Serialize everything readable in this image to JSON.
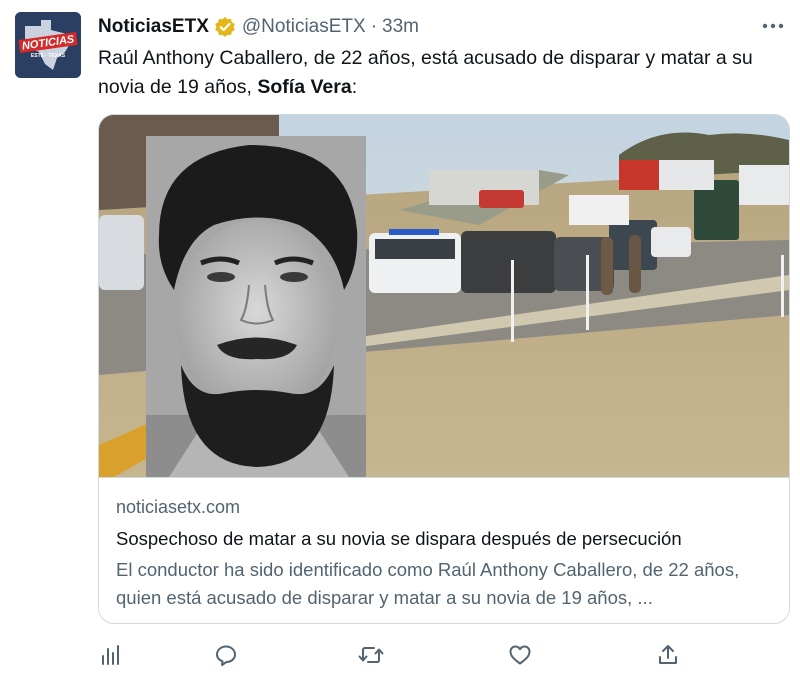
{
  "tweet": {
    "account": {
      "display_name": "NoticiasETX",
      "handle": "@NoticiasETX",
      "separator": "·",
      "time": "33m",
      "avatar_text": "NOTICIAS",
      "avatar_subtext": "ESTE · TEXAS",
      "verified": true
    },
    "text_part1": "Raúl Anthony Caballero, de 22 años, está acusado de disparar y matar a su novia de 19 años, ",
    "text_bold": "Sofía Vera",
    "text_part2": ":",
    "card": {
      "domain": "noticiasetx.com",
      "title": "Sospechoso de matar a su novia se dispara después de persecución",
      "description": "El conductor ha sido identificado como Raúl Anthony Caballero, de 22 años, quien está acusado de disparar y matar a su novia de 19 años, ..."
    },
    "actions": [
      {
        "name": "analytics",
        "icon": "bar-chart-icon"
      },
      {
        "name": "reply",
        "icon": "reply-icon"
      },
      {
        "name": "retweet",
        "icon": "retweet-icon"
      },
      {
        "name": "like",
        "icon": "heart-icon"
      },
      {
        "name": "share",
        "icon": "share-icon"
      }
    ],
    "colors": {
      "text_primary": "#0f1419",
      "text_secondary": "#536471",
      "border": "#cfd9de",
      "verified_badge": "#e2b719"
    }
  }
}
